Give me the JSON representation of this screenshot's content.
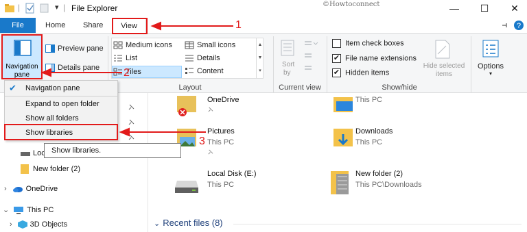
{
  "window": {
    "title": "File Explorer",
    "watermark": "©Howtoconnect",
    "qa_separator": "|",
    "title_separator": "|",
    "qa_dropdown": "▾",
    "minimize": "—",
    "maximize": "☐",
    "close": "✕"
  },
  "tabs": {
    "file": "File",
    "home": "Home",
    "share": "Share",
    "view": "View"
  },
  "ribbon": {
    "panes": {
      "navigation_pane": "Navigation",
      "navigation_pane2": "pane",
      "preview_pane": "Preview pane",
      "details_pane": "Details pane"
    },
    "layout": {
      "medium_icons": "Medium icons",
      "small_icons": "Small icons",
      "list": "List",
      "details": "Details",
      "tiles": "Tiles",
      "content": "Content",
      "label": "Layout"
    },
    "current_view": {
      "sort_by": "Sort",
      "sort_by2": "by",
      "label": "Current view"
    },
    "show_hide": {
      "item_check_boxes": "Item check boxes",
      "file_name_extensions": "File name extensions",
      "hidden_items": "Hidden items",
      "hide_selected": "Hide selected",
      "hide_selected2": "items",
      "label": "Show/hide"
    },
    "options": "Options"
  },
  "nav_dropdown": {
    "items": [
      "Navigation pane",
      "Expand to open folder",
      "Show all folders",
      "Show libraries"
    ]
  },
  "tooltip": "Show libraries.",
  "navpane": {
    "local_disk": "Loc",
    "new_folder": "New folder (2)",
    "onedrive": "OneDrive",
    "this_pc": "This PC",
    "objects_3d": "3D Objects"
  },
  "content": {
    "tiles": [
      {
        "name": "OneDrive",
        "sub": ""
      },
      {
        "name": "",
        "sub": "This PC"
      },
      {
        "name": "Pictures",
        "sub": "This PC"
      },
      {
        "name": "Downloads",
        "sub": "This PC"
      },
      {
        "name": "Local Disk (E:)",
        "sub": "This PC"
      },
      {
        "name": "New folder (2)",
        "sub": "This PC\\Downloads"
      }
    ],
    "recent_files": "Recent files (8)"
  },
  "annotations": [
    "1",
    "2",
    "3"
  ],
  "colors": {
    "accent": "#1979ca",
    "annotation": "#e21a1a",
    "selected": "#cce8ff"
  }
}
